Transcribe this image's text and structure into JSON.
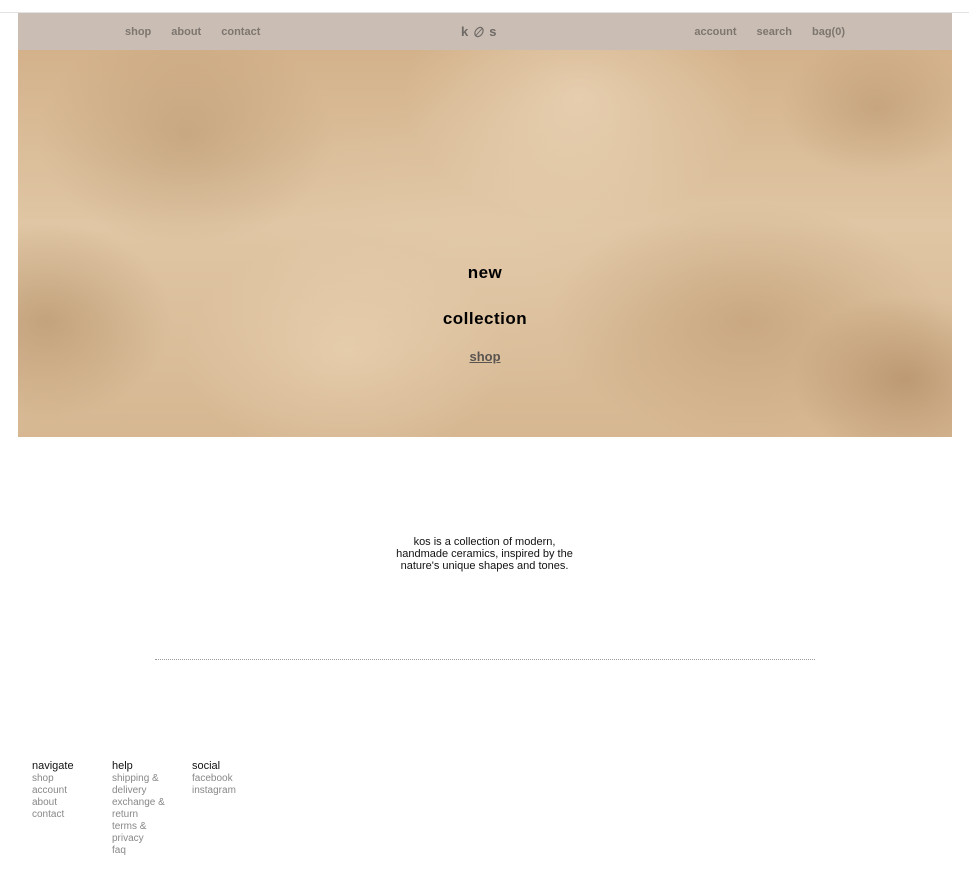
{
  "header": {
    "nav_left": [
      "shop",
      "about",
      "contact"
    ],
    "logo_left": "k",
    "logo_right": "s",
    "nav_right": [
      "account",
      "search",
      "bag(0)"
    ],
    "background_color": "#cabdb3",
    "link_color": "#7d7670"
  },
  "hero": {
    "title_line1": "new",
    "title_line2": "collection",
    "cta": "shop"
  },
  "about": {
    "text": "kos is a collection of modern, handmade ceramics, inspired by the nature's unique shapes and tones."
  },
  "footer": {
    "navigate": {
      "heading": "navigate",
      "links": [
        "shop",
        "account",
        "about",
        "contact"
      ]
    },
    "help": {
      "heading": "help",
      "links": [
        "shipping &",
        "delivery",
        "exchange &",
        "return",
        "terms &",
        "privacy",
        "faq"
      ]
    },
    "social": {
      "heading": "social",
      "links": [
        "facebook",
        "instagram"
      ]
    }
  }
}
